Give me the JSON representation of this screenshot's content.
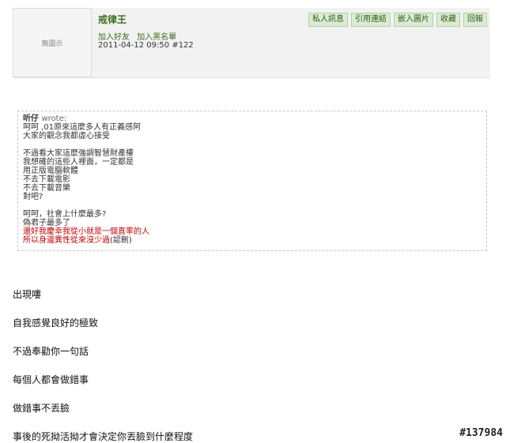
{
  "post": {
    "avatar_text": "無圖示",
    "author": "戒律王",
    "links": [
      "加入好友",
      "加入黑名單"
    ],
    "datetime": "2011-04-12 09:50",
    "post_number": "#122"
  },
  "toolbar": {
    "private_message": "私人訊息",
    "quote_link": "引用連結",
    "insert_image": "嵌入圖片",
    "favorite": "收藏",
    "reply": "回報"
  },
  "quote": {
    "author": "听仔",
    "wrote": "wrote:",
    "lines": [
      "呵呵 ,01原來這麼多人有正義感阿",
      "大家的觀念我都虛心接受",
      "",
      "不過看大家這麼強調智慧財產權",
      "我想確的這些人裡面，一定都是",
      "用正版電腦軟體",
      "不去下載電影",
      "不去下載音樂",
      "對吧?",
      "",
      "呵呵，社會上什麼最多?",
      "偽君子最多了"
    ],
    "red_lines": [
      "還好我慶幸我從小就是一個直率的人",
      "所以身邊異性從來沒少過"
    ],
    "red_suffix": "(認刪)"
  },
  "content": {
    "paragraphs": [
      "出現嘍",
      "自我感覺良好的極致",
      "不過奉勸你一句話",
      "每個人都會做錯事",
      "做錯事不丟臉",
      "事後的死拗活拗才會決定你丟臉到什麼程度"
    ]
  },
  "watermark": "#137984"
}
